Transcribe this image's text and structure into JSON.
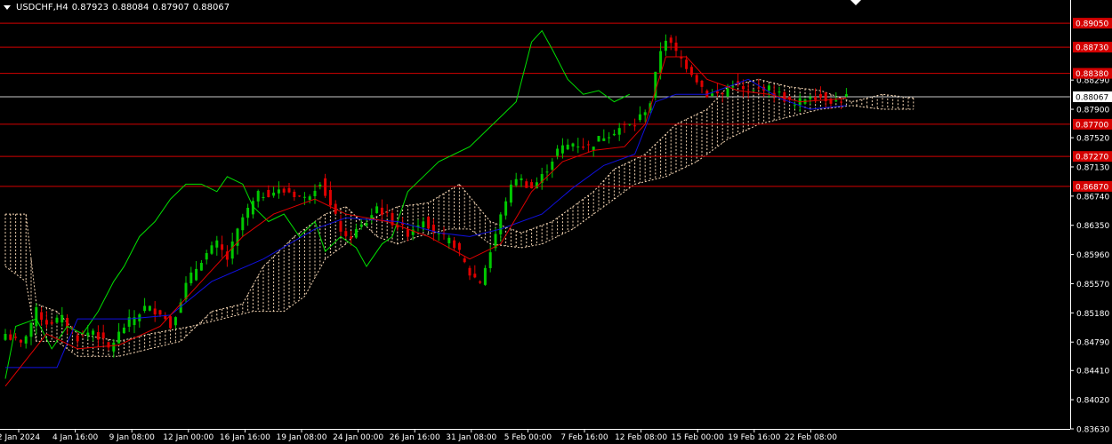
{
  "header": {
    "symbol": "USDCHF,H4",
    "open": "0.87923",
    "high": "0.88084",
    "low": "0.87907",
    "close": "0.88067"
  },
  "colors": {
    "background": "#000000",
    "bull_candle": "#00c800",
    "bear_candle": "#e00000",
    "tenkan": "#e00000",
    "kijun": "#1010e0",
    "chikou": "#00e000",
    "kumo": "#f5d6b4",
    "level_line": "#d40000",
    "price_line": "#c8c8c8",
    "axis_text": "#ffffff",
    "axis_line": "#ffffff"
  },
  "chart_data": {
    "type": "candlestick",
    "title": "USDCHF,H4",
    "indicator": "Ichimoku Kinko Hyo",
    "ylim": [
      0.8363,
      0.8917
    ],
    "y_ticks": [
      "0.88290",
      "0.87900",
      "0.87520",
      "0.87130",
      "0.86740",
      "0.86350",
      "0.85960",
      "0.85570",
      "0.85180",
      "0.84790",
      "0.84410",
      "0.84020",
      "0.83630"
    ],
    "x_ticks": [
      "2 Jan 2024",
      "4 Jan 16:00",
      "9 Jan 08:00",
      "12 Jan 00:00",
      "16 Jan 16:00",
      "19 Jan 08:00",
      "24 Jan 00:00",
      "26 Jan 16:00",
      "31 Jan 08:00",
      "5 Feb 00:00",
      "7 Feb 16:00",
      "12 Feb 08:00",
      "15 Feb 00:00",
      "19 Feb 16:00",
      "22 Feb 08:00"
    ],
    "current_price": "0.88067",
    "levels": [
      {
        "label": "0.89050",
        "value": 0.8905
      },
      {
        "label": "0.88730",
        "value": 0.8873
      },
      {
        "label": "0.88380",
        "value": 0.8838
      },
      {
        "label": "0.87700",
        "value": 0.877
      },
      {
        "label": "0.87270",
        "value": 0.8727
      },
      {
        "label": "0.86870",
        "value": 0.8687
      }
    ],
    "close_path": [
      [
        0,
        0.849
      ],
      [
        3,
        0.8475
      ],
      [
        6,
        0.852
      ],
      [
        8,
        0.8505
      ],
      [
        11,
        0.851
      ],
      [
        14,
        0.8485
      ],
      [
        17,
        0.8495
      ],
      [
        20,
        0.847
      ],
      [
        23,
        0.85
      ],
      [
        27,
        0.8525
      ],
      [
        30,
        0.852
      ],
      [
        32,
        0.85
      ],
      [
        35,
        0.8555
      ],
      [
        38,
        0.859
      ],
      [
        41,
        0.861
      ],
      [
        43,
        0.859
      ],
      [
        46,
        0.8645
      ],
      [
        49,
        0.8675
      ],
      [
        52,
        0.868
      ],
      [
        55,
        0.868
      ],
      [
        58,
        0.867
      ],
      [
        61,
        0.8695
      ],
      [
        63,
        0.866
      ],
      [
        66,
        0.8615
      ],
      [
        70,
        0.864
      ],
      [
        72,
        0.866
      ],
      [
        75,
        0.864
      ],
      [
        78,
        0.8625
      ],
      [
        81,
        0.8645
      ],
      [
        84,
        0.862
      ],
      [
        87,
        0.861
      ],
      [
        90,
        0.857
      ],
      [
        92,
        0.856
      ],
      [
        94,
        0.86
      ],
      [
        97,
        0.867
      ],
      [
        99,
        0.87
      ],
      [
        102,
        0.8685
      ],
      [
        104,
        0.87
      ],
      [
        107,
        0.8735
      ],
      [
        110,
        0.8745
      ],
      [
        113,
        0.874
      ],
      [
        116,
        0.8755
      ],
      [
        119,
        0.8765
      ],
      [
        122,
        0.877
      ],
      [
        125,
        0.88
      ],
      [
        127,
        0.887
      ],
      [
        128,
        0.8885
      ],
      [
        130,
        0.8865
      ],
      [
        133,
        0.884
      ],
      [
        136,
        0.881
      ],
      [
        139,
        0.881
      ],
      [
        141,
        0.8825
      ],
      [
        144,
        0.881
      ],
      [
        147,
        0.882
      ],
      [
        150,
        0.881
      ],
      [
        153,
        0.8795
      ],
      [
        156,
        0.881
      ],
      [
        159,
        0.8805
      ],
      [
        161,
        0.88
      ],
      [
        163,
        0.8807
      ]
    ],
    "tenkan": [
      [
        0,
        0.842
      ],
      [
        8,
        0.849
      ],
      [
        14,
        0.847
      ],
      [
        22,
        0.8475
      ],
      [
        30,
        0.85
      ],
      [
        38,
        0.856
      ],
      [
        46,
        0.862
      ],
      [
        52,
        0.865
      ],
      [
        60,
        0.867
      ],
      [
        66,
        0.865
      ],
      [
        74,
        0.864
      ],
      [
        82,
        0.862
      ],
      [
        90,
        0.859
      ],
      [
        96,
        0.861
      ],
      [
        102,
        0.868
      ],
      [
        108,
        0.872
      ],
      [
        114,
        0.8735
      ],
      [
        120,
        0.874
      ],
      [
        124,
        0.877
      ],
      [
        128,
        0.886
      ],
      [
        132,
        0.886
      ],
      [
        136,
        0.883
      ],
      [
        142,
        0.8815
      ],
      [
        148,
        0.881
      ],
      [
        154,
        0.88
      ],
      [
        160,
        0.8803
      ],
      [
        163,
        0.8805
      ]
    ],
    "kijun": [
      [
        0,
        0.8445
      ],
      [
        10,
        0.8445
      ],
      [
        14,
        0.851
      ],
      [
        24,
        0.851
      ],
      [
        32,
        0.8515
      ],
      [
        40,
        0.856
      ],
      [
        50,
        0.859
      ],
      [
        60,
        0.863
      ],
      [
        66,
        0.8645
      ],
      [
        76,
        0.864
      ],
      [
        84,
        0.8625
      ],
      [
        90,
        0.862
      ],
      [
        96,
        0.863
      ],
      [
        104,
        0.865
      ],
      [
        110,
        0.8685
      ],
      [
        116,
        0.8715
      ],
      [
        122,
        0.873
      ],
      [
        126,
        0.88
      ],
      [
        130,
        0.881
      ],
      [
        136,
        0.881
      ],
      [
        144,
        0.883
      ],
      [
        150,
        0.8805
      ],
      [
        156,
        0.879
      ],
      [
        163,
        0.8795
      ]
    ],
    "chikou": [
      [
        0,
        0.843
      ],
      [
        2,
        0.85
      ],
      [
        6,
        0.851
      ],
      [
        9,
        0.847
      ],
      [
        12,
        0.85
      ],
      [
        15,
        0.849
      ],
      [
        18,
        0.852
      ],
      [
        21,
        0.856
      ],
      [
        23,
        0.858
      ],
      [
        26,
        0.862
      ],
      [
        29,
        0.864
      ],
      [
        32,
        0.867
      ],
      [
        35,
        0.869
      ],
      [
        38,
        0.869
      ],
      [
        41,
        0.868
      ],
      [
        43,
        0.87
      ],
      [
        46,
        0.869
      ],
      [
        48,
        0.866
      ],
      [
        51,
        0.864
      ],
      [
        54,
        0.865
      ],
      [
        57,
        0.862
      ],
      [
        60,
        0.864
      ],
      [
        62,
        0.86
      ],
      [
        65,
        0.862
      ],
      [
        68,
        0.8605
      ],
      [
        70,
        0.858
      ],
      [
        73,
        0.861
      ],
      [
        75,
        0.862
      ],
      [
        78,
        0.868
      ],
      [
        81,
        0.87
      ],
      [
        84,
        0.872
      ],
      [
        87,
        0.873
      ],
      [
        90,
        0.874
      ],
      [
        93,
        0.876
      ],
      [
        96,
        0.878
      ],
      [
        99,
        0.88
      ],
      [
        102,
        0.888
      ],
      [
        104,
        0.8895
      ],
      [
        106,
        0.887
      ],
      [
        109,
        0.883
      ],
      [
        112,
        0.881
      ],
      [
        115,
        0.8815
      ],
      [
        118,
        0.88
      ],
      [
        121,
        0.881
      ]
    ],
    "span_a": [
      [
        0,
        0.865
      ],
      [
        4,
        0.865
      ],
      [
        6,
        0.853
      ],
      [
        10,
        0.852
      ],
      [
        14,
        0.849
      ],
      [
        22,
        0.848
      ],
      [
        28,
        0.849
      ],
      [
        36,
        0.85
      ],
      [
        42,
        0.851
      ],
      [
        48,
        0.852
      ],
      [
        54,
        0.852
      ],
      [
        58,
        0.854
      ],
      [
        62,
        0.859
      ],
      [
        66,
        0.861
      ],
      [
        70,
        0.864
      ],
      [
        76,
        0.866
      ],
      [
        82,
        0.8665
      ],
      [
        88,
        0.869
      ],
      [
        94,
        0.864
      ],
      [
        100,
        0.8625
      ],
      [
        106,
        0.864
      ],
      [
        110,
        0.866
      ],
      [
        114,
        0.868
      ],
      [
        118,
        0.871
      ],
      [
        124,
        0.873
      ],
      [
        130,
        0.877
      ],
      [
        136,
        0.879
      ],
      [
        140,
        0.882
      ],
      [
        146,
        0.883
      ],
      [
        152,
        0.882
      ],
      [
        158,
        0.8815
      ],
      [
        164,
        0.88
      ],
      [
        170,
        0.881
      ],
      [
        176,
        0.8805
      ]
    ],
    "span_b": [
      [
        0,
        0.858
      ],
      [
        4,
        0.856
      ],
      [
        6,
        0.848
      ],
      [
        10,
        0.848
      ],
      [
        14,
        0.846
      ],
      [
        22,
        0.846
      ],
      [
        28,
        0.847
      ],
      [
        34,
        0.848
      ],
      [
        40,
        0.852
      ],
      [
        46,
        0.853
      ],
      [
        50,
        0.858
      ],
      [
        56,
        0.862
      ],
      [
        62,
        0.865
      ],
      [
        66,
        0.866
      ],
      [
        72,
        0.862
      ],
      [
        76,
        0.861
      ],
      [
        80,
        0.862
      ],
      [
        86,
        0.863
      ],
      [
        90,
        0.863
      ],
      [
        94,
        0.861
      ],
      [
        100,
        0.8605
      ],
      [
        104,
        0.861
      ],
      [
        110,
        0.863
      ],
      [
        116,
        0.866
      ],
      [
        122,
        0.869
      ],
      [
        128,
        0.87
      ],
      [
        134,
        0.872
      ],
      [
        140,
        0.875
      ],
      [
        146,
        0.877
      ],
      [
        152,
        0.878
      ],
      [
        158,
        0.879
      ],
      [
        164,
        0.8795
      ],
      [
        170,
        0.879
      ],
      [
        176,
        0.879
      ]
    ]
  }
}
